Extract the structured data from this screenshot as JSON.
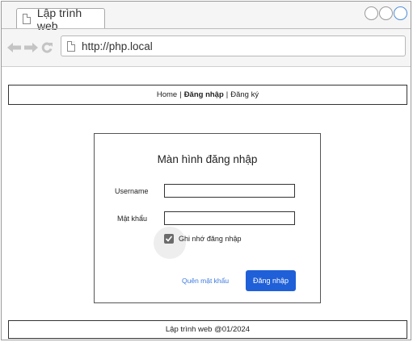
{
  "browser": {
    "tab_title": "Lập trình web",
    "url": "http://php.local",
    "accent_color": "#4f8fd8"
  },
  "header": {
    "nav_home": "Home",
    "separator": "|",
    "nav_login": "Đăng nhập",
    "nav_register": "Đăng ký"
  },
  "login": {
    "title": "Màn hình đăng nhập",
    "username_label": "Username",
    "username_value": "",
    "password_label": "Mật khẩu",
    "password_value": "",
    "remember_label": "Ghi nhớ đăng nhập",
    "remember_checked": true,
    "forgot_link": "Quên mật khẩu",
    "submit_label": "Đăng nhập",
    "button_color": "#1f5fd8",
    "link_color": "#3b7ae0"
  },
  "footer": {
    "text": "Lập trình web @01/2024"
  }
}
